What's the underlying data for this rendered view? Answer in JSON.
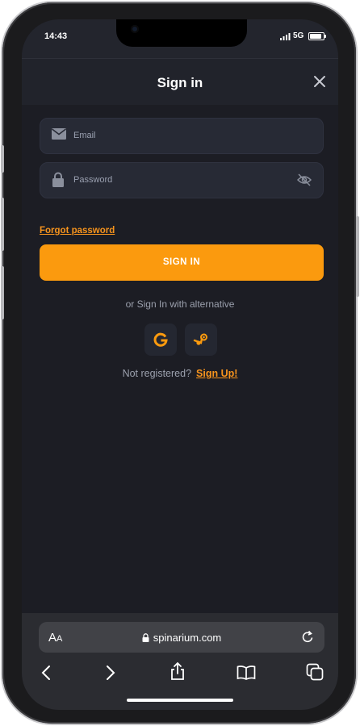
{
  "status_bar": {
    "time": "14:43",
    "network": "5G",
    "battery_fraction": 0.85
  },
  "modal": {
    "title": "Sign in",
    "email_placeholder": "Email",
    "password_placeholder": "Password",
    "forgot_password": "Forgot password",
    "signin_button": "SIGN IN",
    "alternative_text": "or Sign In with alternative",
    "not_registered": "Not registered?",
    "signup_link": "Sign Up!"
  },
  "social_buttons": [
    {
      "name": "google",
      "icon": "google-icon"
    },
    {
      "name": "steam",
      "icon": "steam-icon"
    }
  ],
  "browser": {
    "text_size_label_big": "A",
    "text_size_label_small": "A",
    "url": "spinarium.com"
  },
  "colors": {
    "accent": "#fb9a0e",
    "background": "#1c1d24",
    "field": "#272a35",
    "link": "#f7941d"
  }
}
